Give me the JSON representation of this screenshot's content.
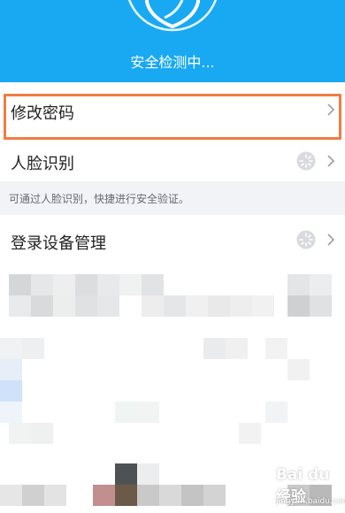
{
  "header": {
    "status": "安全检测中...",
    "colors": {
      "background": "#19a9f3"
    }
  },
  "items": [
    {
      "label": "修改密码"
    },
    {
      "label": "人脸识别"
    },
    {
      "label": "登录设备管理"
    }
  ],
  "face_hint": "可通过人脸识别，快捷进行安全验证。",
  "highlight_color": "#ef7d43",
  "watermark": {
    "text": "Bai du 经验",
    "sub": "jingyan.baidu.com"
  }
}
